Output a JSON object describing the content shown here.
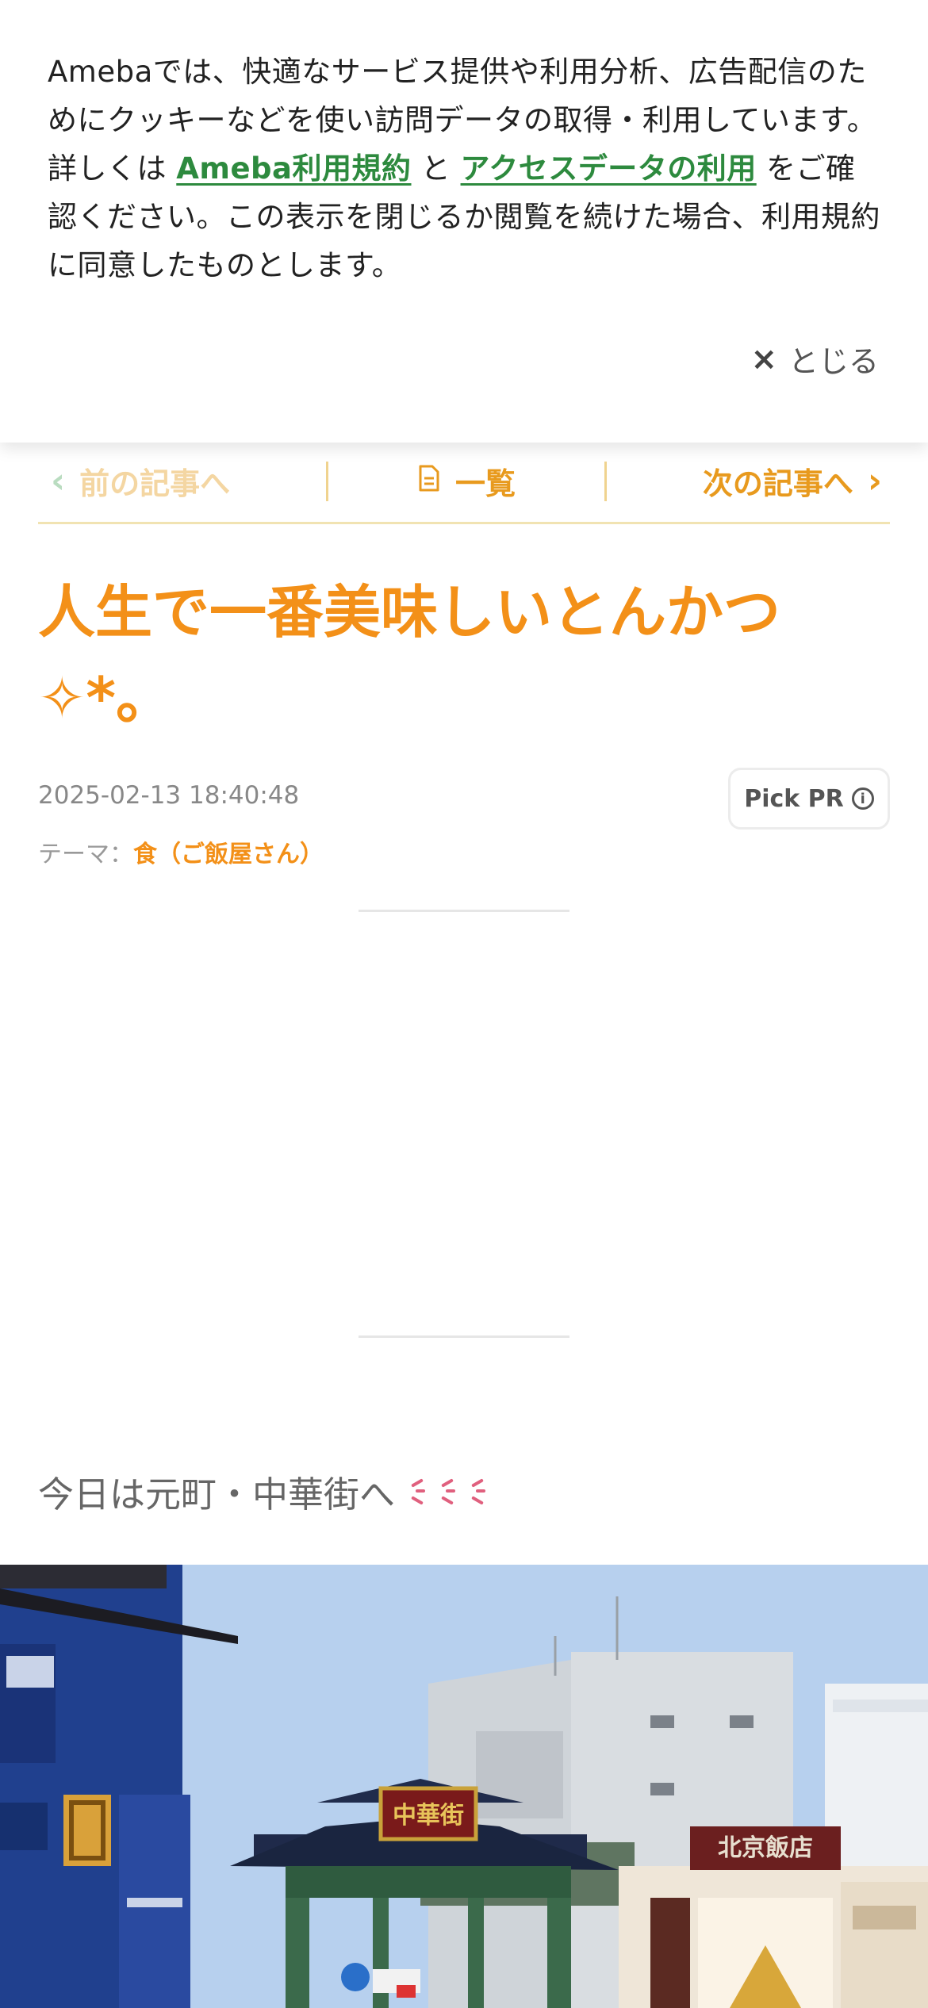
{
  "cookie_banner": {
    "text_before": "Amebaでは、快適なサービス提供や利用分析、広告配信のためにクッキーなどを使い訪問データの取得・利用しています。詳しくは ",
    "link_terms": "Ameba利用規約",
    "text_and": " と ",
    "link_access": "アクセスデータの利用",
    "text_after": " をご確認ください。この表示を閉じるか閲覧を続けた場合、利用規約に同意したものとします。",
    "close_label": "とじる",
    "close_icon": "×"
  },
  "article_nav": {
    "prev_label": "前の記事へ",
    "list_label": "一覧",
    "next_label": "次の記事へ"
  },
  "article": {
    "title": "人生で一番美味しいとんかつ✧*。",
    "datetime": "2025-02-13 18:40:48",
    "theme_label": "テーマ：",
    "theme_value": "食（ご飯屋さん）",
    "pickpr_label": "Pick PR",
    "first_line": "今日は元町・中華街へ",
    "photo_sign_gate": "中華街",
    "photo_sign_restaurant": "北京飯店"
  },
  "colors": {
    "accent": "#f39018",
    "link_green": "#2d8a3e",
    "nav_divider": "#f1e3b2"
  }
}
